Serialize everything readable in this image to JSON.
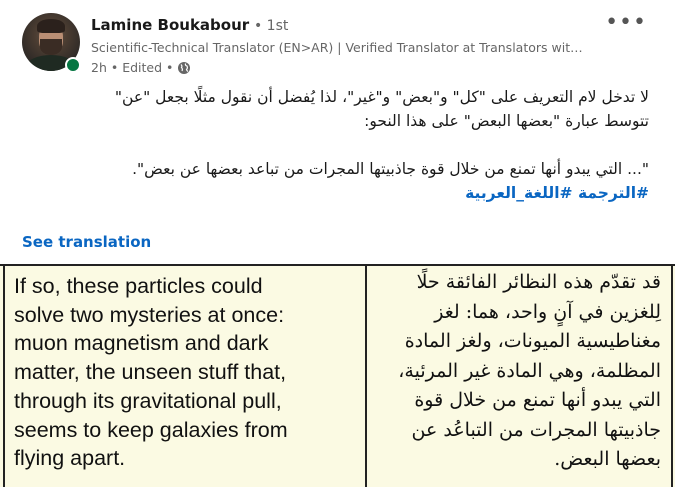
{
  "author": {
    "name": "Lamine Boukabour",
    "degree": "• 1st",
    "headline": "Scientific-Technical Translator (EN>AR) | Verified Translator at Translators wit…",
    "time": "2h • Edited •",
    "presence_color": "#057642"
  },
  "menu": {
    "icon": "more-horizontal-icon",
    "label": "•••"
  },
  "post": {
    "line1": "لا تدخل لام التعريف على \"كل\" و\"بعض\" و\"غير\"، لذا يُفضل أن نقول مثلًا بجعل \"عن\"",
    "line2": "تتوسط عبارة \"بعضها البعض\" على هذا النحو:",
    "line3": "\"... التي يبدو أنها تمنع من خلال قوة جاذبيتها المجرات من تباعد بعضها عن بعض\".",
    "hashtags": "#الترجمة #اللغة_العربية"
  },
  "see_translation": "See translation",
  "image": {
    "english_lines": [
      "If so, these particles could",
      "solve two mysteries at once:",
      "muon magnetism and dark",
      "matter, the unseen stuff that,",
      "through its gravitational pull,",
      "seems to keep galaxies from",
      "flying apart."
    ],
    "arabic_lines": [
      "قد تقدّم هذه النظائر الفائقة حلًا",
      "لِلغزين في آنٍ واحد، هما: لغز",
      "مغناطيسية الميونات، ولغز المادة",
      "المظلمة، وهي المادة غير المرئية،",
      "التي يبدو أنها تمنع من خلال قوة",
      "جاذبيتها المجرات من التباعُد عن",
      "بعضها البعض."
    ]
  },
  "colors": {
    "link": "#0a66c2",
    "image_bg": "#fbfae3",
    "muted": "#666666"
  }
}
